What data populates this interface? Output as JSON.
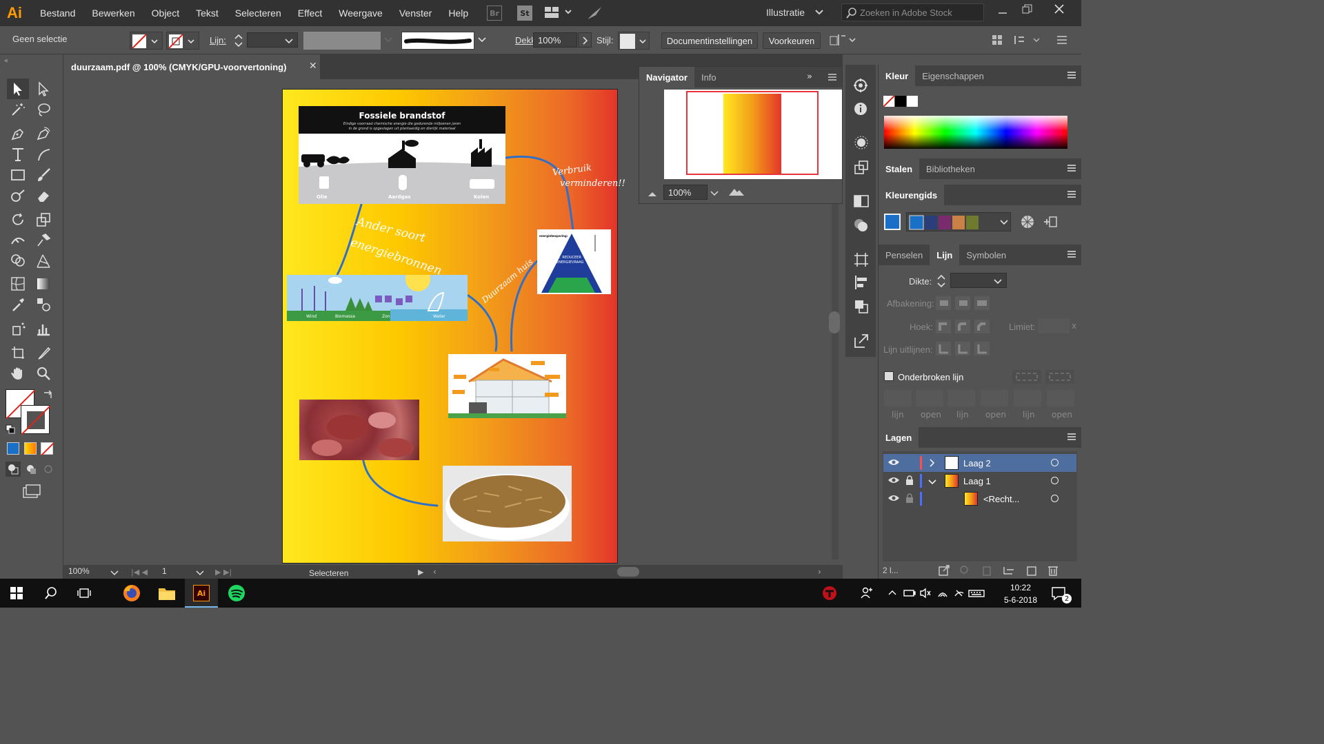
{
  "menubar": {
    "logo": "Ai",
    "items": [
      "Bestand",
      "Bewerken",
      "Object",
      "Tekst",
      "Selecteren",
      "Effect",
      "Weergave",
      "Venster",
      "Help"
    ],
    "br": "Br",
    "st": "St",
    "workspace": "Illustratie",
    "search_placeholder": "Zoeken in Adobe Stock"
  },
  "control": {
    "selection": "Geen selectie",
    "stroke_label": "Lijn:",
    "opacity_label": "Dekking:",
    "opacity_value": "100%",
    "style_label": "Stijl:",
    "doc_settings": "Documentinstellingen",
    "prefs": "Voorkeuren"
  },
  "document": {
    "tab_title": "duurzaam.pdf @ 100% (CMYK/GPU-voorvertoning)",
    "zoom": "100%",
    "artboard": "1",
    "status": "Selecteren",
    "artwork": {
      "fossil_title": "Fossiele brandstof",
      "fossil_sub1": "Eindige voorraad chemische energie die gedurende miljoenen jaren",
      "fossil_sub2": "in de grond is opgeslagen uit plantaardig en dierlijk materiaal",
      "fuel_labels": [
        "Olie",
        "Aardgas",
        "Kolen"
      ],
      "arrow_text_1a": "Ander soort",
      "arrow_text_1b": "energiebronnen",
      "arrow_text_2a": "Verbruik",
      "arrow_text_2b": "verminderen!!",
      "arrow_text_3": "Duurzaam huis",
      "renew_labels": [
        "Wind",
        "Biomassa",
        "Zon",
        "Water"
      ],
      "pyramid_title": "energiebesparing:",
      "pyramid_step1a": "1. REDUCEER",
      "pyramid_step1b": "ENERGIEVRAAG"
    }
  },
  "navigator": {
    "tabs": [
      "Navigator",
      "Info"
    ],
    "zoom": "100%"
  },
  "right_panels": {
    "kleur_tabs": [
      "Kleur",
      "Eigenschappen"
    ],
    "stalen_tabs": [
      "Stalen",
      "Bibliotheken"
    ],
    "kleurengids": "Kleurengids",
    "lijn_tabs": [
      "Penselen",
      "Lijn",
      "Symbolen"
    ],
    "dikte": "Dikte:",
    "afbakening": "Afbakening:",
    "hoek": "Hoek:",
    "limiet": "Limiet:",
    "uitlijnen": "Lijn uitlijnen:",
    "onderbroken": "Onderbroken lijn",
    "dash_labels": [
      "lijn",
      "open",
      "lijn",
      "open",
      "lijn",
      "open"
    ],
    "lagen": "Lagen",
    "layers": [
      {
        "name": "Laag 2",
        "color": "#ff4d4d"
      },
      {
        "name": "Laag 1",
        "color": "#4d6dff"
      },
      {
        "name": "<Recht...",
        "color": "#4d6dff"
      }
    ],
    "layer_count": "2 l..."
  },
  "taskbar": {
    "time": "10:22",
    "date": "5-6-2018",
    "notif": "2"
  },
  "colors": {
    "accent_ai": "#ff9a00",
    "ui_dark": "#323232",
    "ui_mid": "#535353",
    "gradient_start": "#ffe41a",
    "gradient_end": "#e5352b",
    "arrow_blue": "#2f6fc9"
  }
}
